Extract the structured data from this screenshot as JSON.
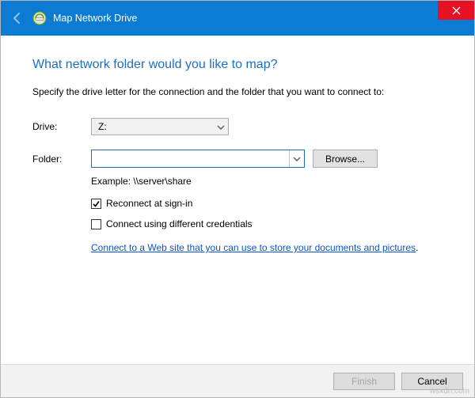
{
  "titlebar": {
    "title": "Map Network Drive"
  },
  "content": {
    "heading": "What network folder would you like to map?",
    "instruction": "Specify the drive letter for the connection and the folder that you want to connect to:",
    "drive_label": "Drive:",
    "drive_value": "Z:",
    "folder_label": "Folder:",
    "folder_value": "",
    "browse_label": "Browse...",
    "example_text": "Example: \\\\server\\share",
    "reconnect_label": "Reconnect at sign-in",
    "diffcreds_label": "Connect using different credentials",
    "link_part1": "Connect to a Web site that you can use to store your documents and pictures",
    "link_period": "."
  },
  "footer": {
    "finish": "Finish",
    "cancel": "Cancel"
  },
  "watermark": "wsxdn.com"
}
